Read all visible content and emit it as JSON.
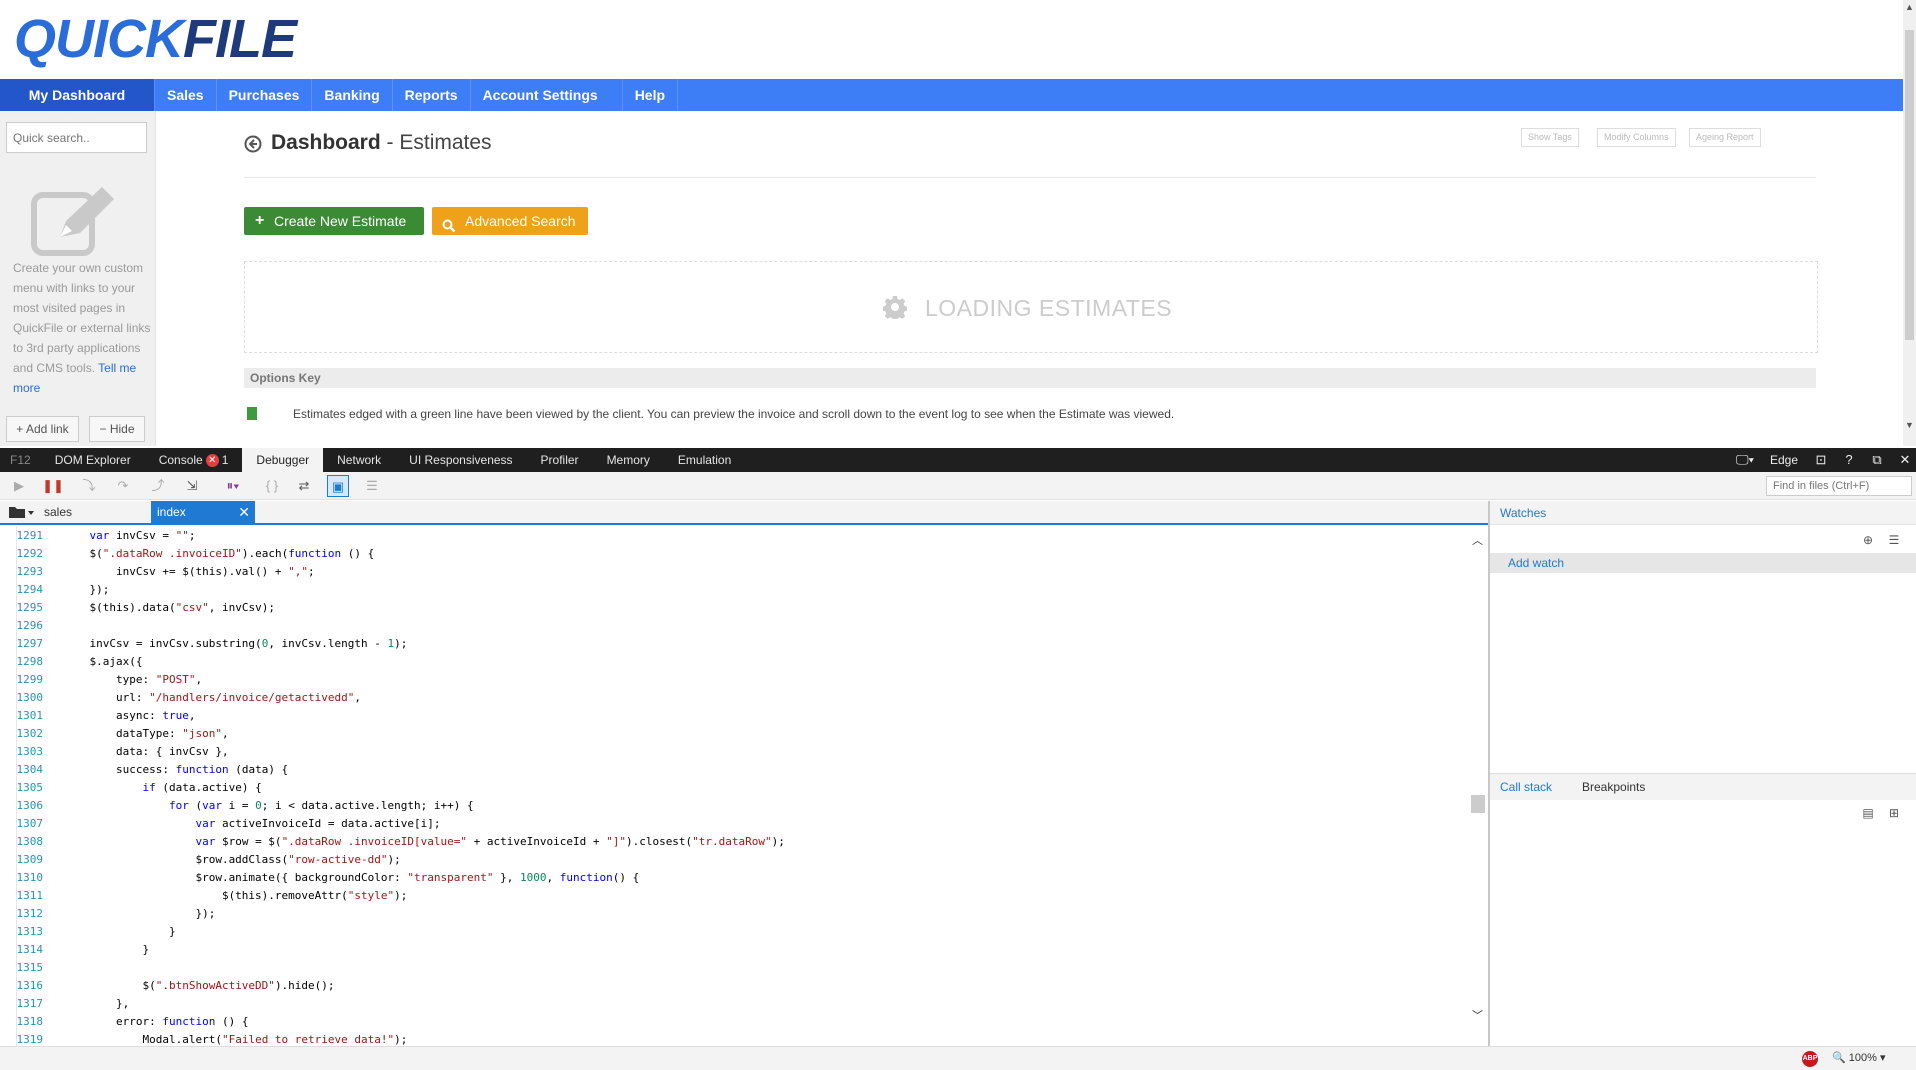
{
  "brand": {
    "logo_q": "Q",
    "logo_rest": "UICK",
    "logo_file": "FILE"
  },
  "nav": {
    "items": [
      {
        "label": "My Dashboard",
        "active": true
      },
      {
        "label": "Sales"
      },
      {
        "label": "Purchases"
      },
      {
        "label": "Banking"
      },
      {
        "label": "Reports"
      },
      {
        "label": "Account Settings"
      },
      {
        "label": "Help"
      }
    ]
  },
  "sidebar": {
    "search_placeholder": "Quick search..",
    "custom_menu_text": "Create your own custom menu with links to your most visited pages in QuickFile or external links to 3rd party applications and CMS tools.",
    "tell_me_more": "Tell me more",
    "add_link": "Add link",
    "hide": "Hide"
  },
  "main": {
    "title_bold": "Dashboard",
    "title_sep": " - ",
    "title_sub": "Estimates",
    "top_buttons": [
      "Show Tags",
      "Modify Columns",
      "Ageing Report"
    ],
    "create_button": "Create New Estimate",
    "advanced_search": "Advanced Search",
    "loading_text": "LOADING ESTIMATES",
    "options_key": "Options Key",
    "options_desc": "Estimates edged with a green line have been viewed by the client. You can preview the invoice and scroll down to the event log to see when the Estimate was viewed."
  },
  "f12": {
    "label": "F12",
    "tabs": [
      "DOM Explorer",
      "Console",
      "Debugger",
      "Network",
      "UI Responsiveness",
      "Profiler",
      "Memory",
      "Emulation"
    ],
    "active_tab": "Debugger",
    "console_errors": "1",
    "edge_mode": "Edge",
    "find_placeholder": "Find in files (Ctrl+F)"
  },
  "debugger": {
    "file_tabs": [
      "sales",
      "index"
    ],
    "active_file": "index",
    "code_lines": [
      {
        "n": "1291",
        "t": "    var invCsv = \"\";"
      },
      {
        "n": "1292",
        "t": "    $(\".dataRow .invoiceID\").each(function () {"
      },
      {
        "n": "1293",
        "t": "        invCsv += $(this).val() + \",\";"
      },
      {
        "n": "1294",
        "t": "    });"
      },
      {
        "n": "1295",
        "t": "    $(this).data(\"csv\", invCsv);"
      },
      {
        "n": "1296",
        "t": ""
      },
      {
        "n": "1297",
        "t": "    invCsv = invCsv.substring(0, invCsv.length - 1);"
      },
      {
        "n": "1298",
        "t": "    $.ajax({"
      },
      {
        "n": "1299",
        "t": "        type: \"POST\","
      },
      {
        "n": "1300",
        "t": "        url: \"/handlers/invoice/getactivedd\","
      },
      {
        "n": "1301",
        "t": "        async: true,"
      },
      {
        "n": "1302",
        "t": "        dataType: \"json\","
      },
      {
        "n": "1303",
        "t": "        data: { invCsv },"
      },
      {
        "n": "1304",
        "t": "        success: function (data) {"
      },
      {
        "n": "1305",
        "t": "            if (data.active) {"
      },
      {
        "n": "1306",
        "t": "                for (var i = 0; i < data.active.length; i++) {"
      },
      {
        "n": "1307",
        "t": "                    var activeInvoiceId = data.active[i];"
      },
      {
        "n": "1308",
        "t": "                    var $row = $(\".dataRow .invoiceID[value=\" + activeInvoiceId + \"]\").closest(\"tr.dataRow\");"
      },
      {
        "n": "1309",
        "t": "                    $row.addClass(\"row-active-dd\");"
      },
      {
        "n": "1310",
        "t": "                    $row.animate({ backgroundColor: \"transparent\" }, 1000, function() {"
      },
      {
        "n": "1311",
        "t": "                        $(this).removeAttr(\"style\");"
      },
      {
        "n": "1312",
        "t": "                    });"
      },
      {
        "n": "1313",
        "t": "                }"
      },
      {
        "n": "1314",
        "t": "            }"
      },
      {
        "n": "1315",
        "t": ""
      },
      {
        "n": "1316",
        "t": "            $(\".btnShowActiveDD\").hide();"
      },
      {
        "n": "1317",
        "t": "        },"
      },
      {
        "n": "1318",
        "t": "        error: function () {"
      },
      {
        "n": "1319",
        "t": "            Modal.alert(\"Failed to retrieve data!\");"
      }
    ]
  },
  "watches": {
    "title": "Watches",
    "add_watch": "Add watch"
  },
  "callstack": {
    "tabs": [
      "Call stack",
      "Breakpoints"
    ],
    "active": "Call stack"
  },
  "status": {
    "zoom": "100%",
    "adblock": "ABP"
  }
}
